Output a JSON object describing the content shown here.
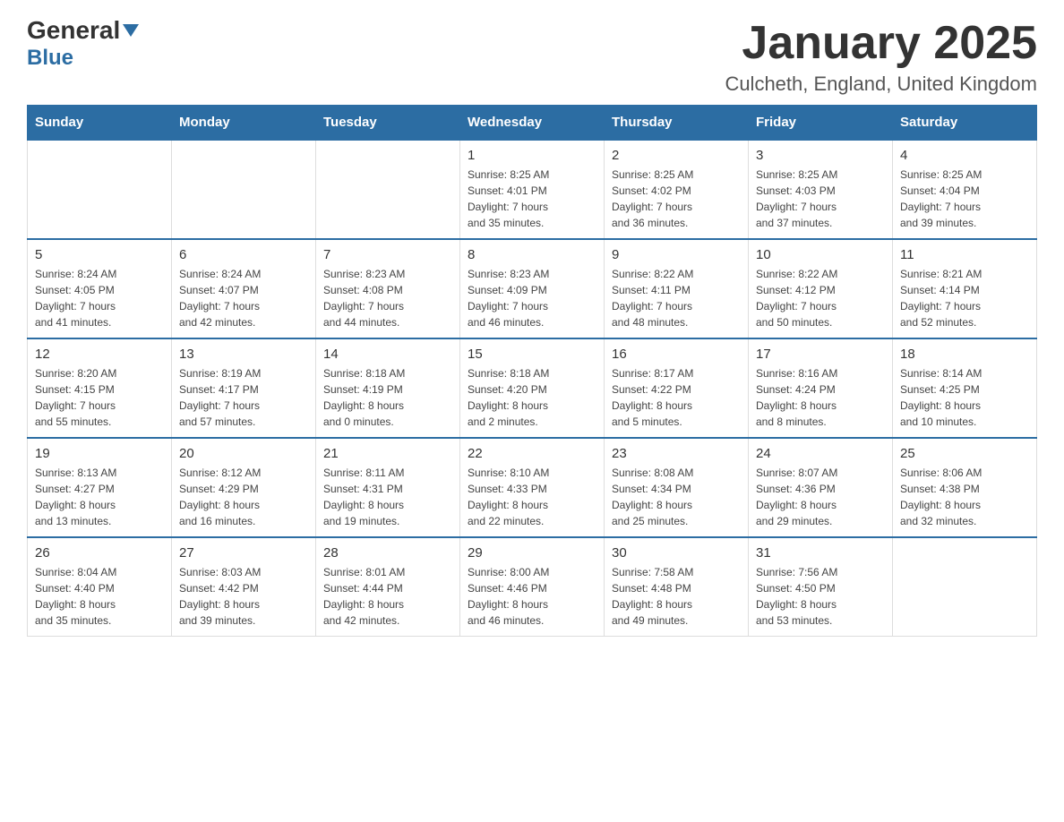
{
  "header": {
    "logo_general": "General",
    "logo_blue": "Blue",
    "month_title": "January 2025",
    "location": "Culcheth, England, United Kingdom"
  },
  "days_of_week": [
    "Sunday",
    "Monday",
    "Tuesday",
    "Wednesday",
    "Thursday",
    "Friday",
    "Saturday"
  ],
  "weeks": [
    [
      {
        "day": "",
        "info": ""
      },
      {
        "day": "",
        "info": ""
      },
      {
        "day": "",
        "info": ""
      },
      {
        "day": "1",
        "info": "Sunrise: 8:25 AM\nSunset: 4:01 PM\nDaylight: 7 hours\nand 35 minutes."
      },
      {
        "day": "2",
        "info": "Sunrise: 8:25 AM\nSunset: 4:02 PM\nDaylight: 7 hours\nand 36 minutes."
      },
      {
        "day": "3",
        "info": "Sunrise: 8:25 AM\nSunset: 4:03 PM\nDaylight: 7 hours\nand 37 minutes."
      },
      {
        "day": "4",
        "info": "Sunrise: 8:25 AM\nSunset: 4:04 PM\nDaylight: 7 hours\nand 39 minutes."
      }
    ],
    [
      {
        "day": "5",
        "info": "Sunrise: 8:24 AM\nSunset: 4:05 PM\nDaylight: 7 hours\nand 41 minutes."
      },
      {
        "day": "6",
        "info": "Sunrise: 8:24 AM\nSunset: 4:07 PM\nDaylight: 7 hours\nand 42 minutes."
      },
      {
        "day": "7",
        "info": "Sunrise: 8:23 AM\nSunset: 4:08 PM\nDaylight: 7 hours\nand 44 minutes."
      },
      {
        "day": "8",
        "info": "Sunrise: 8:23 AM\nSunset: 4:09 PM\nDaylight: 7 hours\nand 46 minutes."
      },
      {
        "day": "9",
        "info": "Sunrise: 8:22 AM\nSunset: 4:11 PM\nDaylight: 7 hours\nand 48 minutes."
      },
      {
        "day": "10",
        "info": "Sunrise: 8:22 AM\nSunset: 4:12 PM\nDaylight: 7 hours\nand 50 minutes."
      },
      {
        "day": "11",
        "info": "Sunrise: 8:21 AM\nSunset: 4:14 PM\nDaylight: 7 hours\nand 52 minutes."
      }
    ],
    [
      {
        "day": "12",
        "info": "Sunrise: 8:20 AM\nSunset: 4:15 PM\nDaylight: 7 hours\nand 55 minutes."
      },
      {
        "day": "13",
        "info": "Sunrise: 8:19 AM\nSunset: 4:17 PM\nDaylight: 7 hours\nand 57 minutes."
      },
      {
        "day": "14",
        "info": "Sunrise: 8:18 AM\nSunset: 4:19 PM\nDaylight: 8 hours\nand 0 minutes."
      },
      {
        "day": "15",
        "info": "Sunrise: 8:18 AM\nSunset: 4:20 PM\nDaylight: 8 hours\nand 2 minutes."
      },
      {
        "day": "16",
        "info": "Sunrise: 8:17 AM\nSunset: 4:22 PM\nDaylight: 8 hours\nand 5 minutes."
      },
      {
        "day": "17",
        "info": "Sunrise: 8:16 AM\nSunset: 4:24 PM\nDaylight: 8 hours\nand 8 minutes."
      },
      {
        "day": "18",
        "info": "Sunrise: 8:14 AM\nSunset: 4:25 PM\nDaylight: 8 hours\nand 10 minutes."
      }
    ],
    [
      {
        "day": "19",
        "info": "Sunrise: 8:13 AM\nSunset: 4:27 PM\nDaylight: 8 hours\nand 13 minutes."
      },
      {
        "day": "20",
        "info": "Sunrise: 8:12 AM\nSunset: 4:29 PM\nDaylight: 8 hours\nand 16 minutes."
      },
      {
        "day": "21",
        "info": "Sunrise: 8:11 AM\nSunset: 4:31 PM\nDaylight: 8 hours\nand 19 minutes."
      },
      {
        "day": "22",
        "info": "Sunrise: 8:10 AM\nSunset: 4:33 PM\nDaylight: 8 hours\nand 22 minutes."
      },
      {
        "day": "23",
        "info": "Sunrise: 8:08 AM\nSunset: 4:34 PM\nDaylight: 8 hours\nand 25 minutes."
      },
      {
        "day": "24",
        "info": "Sunrise: 8:07 AM\nSunset: 4:36 PM\nDaylight: 8 hours\nand 29 minutes."
      },
      {
        "day": "25",
        "info": "Sunrise: 8:06 AM\nSunset: 4:38 PM\nDaylight: 8 hours\nand 32 minutes."
      }
    ],
    [
      {
        "day": "26",
        "info": "Sunrise: 8:04 AM\nSunset: 4:40 PM\nDaylight: 8 hours\nand 35 minutes."
      },
      {
        "day": "27",
        "info": "Sunrise: 8:03 AM\nSunset: 4:42 PM\nDaylight: 8 hours\nand 39 minutes."
      },
      {
        "day": "28",
        "info": "Sunrise: 8:01 AM\nSunset: 4:44 PM\nDaylight: 8 hours\nand 42 minutes."
      },
      {
        "day": "29",
        "info": "Sunrise: 8:00 AM\nSunset: 4:46 PM\nDaylight: 8 hours\nand 46 minutes."
      },
      {
        "day": "30",
        "info": "Sunrise: 7:58 AM\nSunset: 4:48 PM\nDaylight: 8 hours\nand 49 minutes."
      },
      {
        "day": "31",
        "info": "Sunrise: 7:56 AM\nSunset: 4:50 PM\nDaylight: 8 hours\nand 53 minutes."
      },
      {
        "day": "",
        "info": ""
      }
    ]
  ]
}
